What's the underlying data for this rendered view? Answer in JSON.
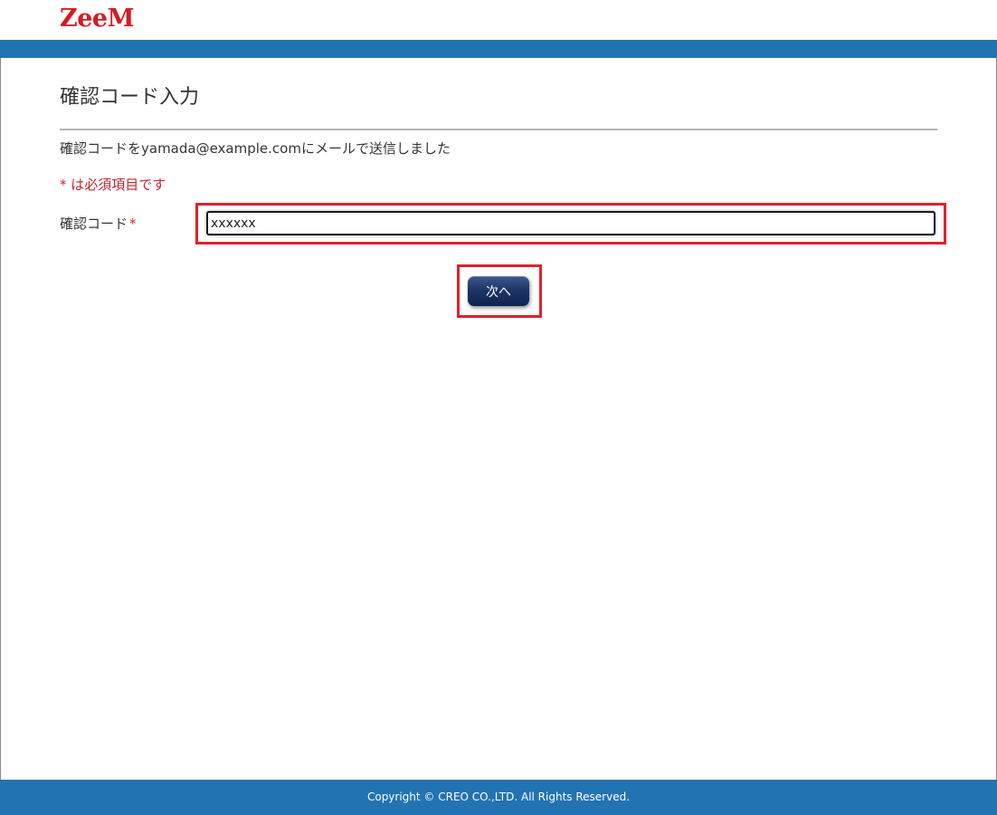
{
  "header": {
    "logo_text": "ZeeM",
    "logo_color": "#d51a22",
    "bar_color": "#2273b2"
  },
  "main": {
    "title": "確認コード入力",
    "message": "確認コードをyamada@example.comにメールで送信しました",
    "required_note": "* は必須項目です",
    "form": {
      "code_label": "確認コード",
      "required_mark": "*",
      "code_value": "xxxxxx",
      "next_button_label": "次へ"
    }
  },
  "footer": {
    "copyright": "Copyright © CREO CO.,LTD. All Rights Reserved."
  },
  "colors": {
    "accent_blue": "#2273b2",
    "required_red": "#c0262d",
    "highlight_red": "#e0212b",
    "button_navy": "#1d3566"
  }
}
